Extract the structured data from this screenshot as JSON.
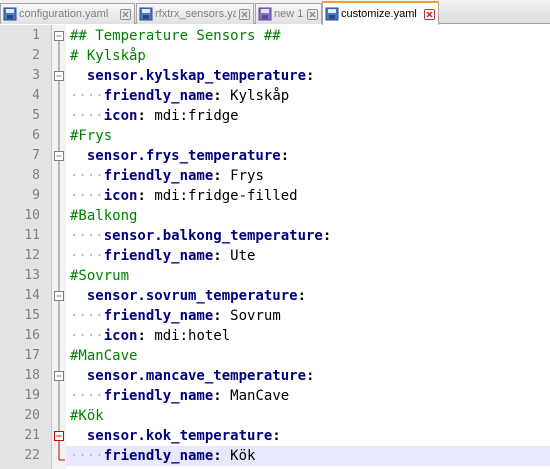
{
  "tabs": [
    {
      "label": "configuration.yaml",
      "icon": "saved-file-icon",
      "active": false
    },
    {
      "label": "rfxtrx_sensors.yaml",
      "icon": "saved-file-icon",
      "active": false
    },
    {
      "label": "new 1",
      "icon": "unsaved-file-icon",
      "active": false
    },
    {
      "label": "customize.yaml",
      "icon": "saved-file-icon",
      "active": true
    }
  ],
  "colors": {
    "comment": "#008000",
    "key": "#000080",
    "current_line": "#e8e8ff",
    "active_tab_accent": "#f0a030",
    "fold_error": "#cc0000"
  },
  "lines": [
    {
      "num": "1",
      "indent": "",
      "comment": "## Temperature Sensors ##"
    },
    {
      "num": "2",
      "indent": "",
      "comment": "# Kylskåp"
    },
    {
      "num": "3",
      "indent": "  ",
      "key": "sensor.kylskap_temperature",
      "value": ""
    },
    {
      "num": "4",
      "indent": "····",
      "key": "friendly_name",
      "value": "Kylskåp"
    },
    {
      "num": "5",
      "indent": "····",
      "key": "icon",
      "value": "mdi:fridge"
    },
    {
      "num": "6",
      "indent": "",
      "comment": "#Frys"
    },
    {
      "num": "7",
      "indent": "  ",
      "key": "sensor.frys_temperature",
      "value": ""
    },
    {
      "num": "8",
      "indent": "····",
      "key": "friendly_name",
      "value": "Frys"
    },
    {
      "num": "9",
      "indent": "····",
      "key": "icon",
      "value": "mdi:fridge-filled"
    },
    {
      "num": "10",
      "indent": "",
      "comment": "#Balkong"
    },
    {
      "num": "11",
      "indent": "····",
      "key": "sensor.balkong_temperature",
      "value": ""
    },
    {
      "num": "12",
      "indent": "····",
      "key": "friendly_name",
      "value": "Ute"
    },
    {
      "num": "13",
      "indent": "",
      "comment": "#Sovrum"
    },
    {
      "num": "14",
      "indent": "  ",
      "key": "sensor.sovrum_temperature",
      "value": ""
    },
    {
      "num": "15",
      "indent": "····",
      "key": "friendly_name",
      "value": "Sovrum"
    },
    {
      "num": "16",
      "indent": "····",
      "key": "icon",
      "value": "mdi:hotel"
    },
    {
      "num": "17",
      "indent": "",
      "comment": "#ManCave"
    },
    {
      "num": "18",
      "indent": "  ",
      "key": "sensor.mancave_temperature",
      "value": ""
    },
    {
      "num": "19",
      "indent": "····",
      "key": "friendly_name",
      "value": "ManCave"
    },
    {
      "num": "20",
      "indent": "",
      "comment": "#Kök"
    },
    {
      "num": "21",
      "indent": "  ",
      "key": "sensor.kok_temperature",
      "value": ""
    },
    {
      "num": "22",
      "indent": "····",
      "key": "friendly_name",
      "value": "Kök"
    }
  ],
  "folds": {
    "1": "box-minus",
    "2": "line",
    "3": "box-minus",
    "4": "line",
    "5": "line",
    "6": "line",
    "7": "box-minus",
    "8": "line",
    "9": "line",
    "10": "line",
    "11": "line",
    "12": "line",
    "13": "line",
    "14": "box-minus",
    "15": "line",
    "16": "line",
    "17": "line",
    "18": "box-minus",
    "19": "line",
    "20": "line",
    "21": "box-minus-red",
    "22": "end-red"
  },
  "current_line": "22"
}
